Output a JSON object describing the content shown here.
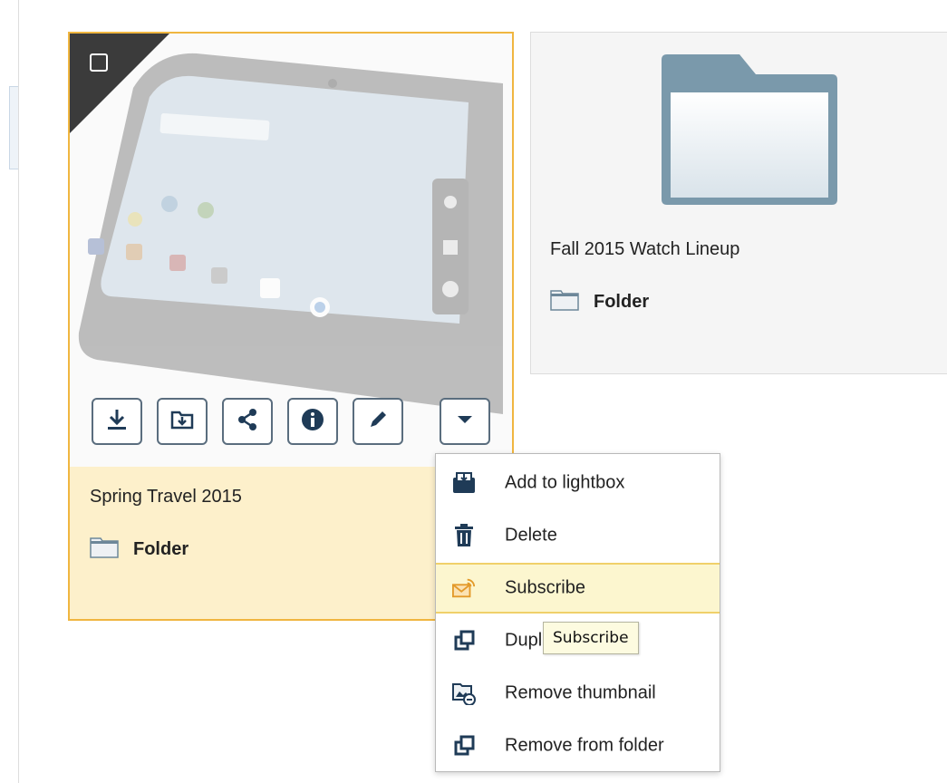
{
  "cards": [
    {
      "title": "Spring Travel 2015",
      "type_label": "Folder",
      "selected": true,
      "actions": [
        {
          "icon": "download-icon",
          "name": "download-button"
        },
        {
          "icon": "move-to-folder-icon",
          "name": "move-to-folder-button"
        },
        {
          "icon": "share-icon",
          "name": "share-button"
        },
        {
          "icon": "info-icon",
          "name": "info-button"
        },
        {
          "icon": "pencil-icon",
          "name": "edit-button"
        },
        {
          "icon": "caret-down-icon",
          "name": "more-actions-button"
        }
      ]
    },
    {
      "title": "Fall 2015 Watch Lineup",
      "type_label": "Folder",
      "selected": false
    }
  ],
  "menu": {
    "items": [
      {
        "label": "Add to lightbox",
        "icon": "lightbox-add-icon",
        "active": false
      },
      {
        "label": "Delete",
        "icon": "trash-icon",
        "active": false
      },
      {
        "label": "Subscribe",
        "icon": "subscribe-rss-mail-icon",
        "active": true
      },
      {
        "label": "Duplicate",
        "icon": "duplicate-icon",
        "active": false
      },
      {
        "label": "Remove thumbnail",
        "icon": "remove-thumbnail-icon",
        "active": false
      },
      {
        "label": "Remove from folder",
        "icon": "remove-from-folder-icon",
        "active": false
      }
    ]
  },
  "tooltip": {
    "text": "Subscribe"
  },
  "colors": {
    "selected_border": "#f0b640",
    "selected_bg": "#fdf0cb",
    "folder_blue": "#7a99ab",
    "icon_dark": "#1f3b57",
    "subscribe_orange": "#e39a2a"
  }
}
